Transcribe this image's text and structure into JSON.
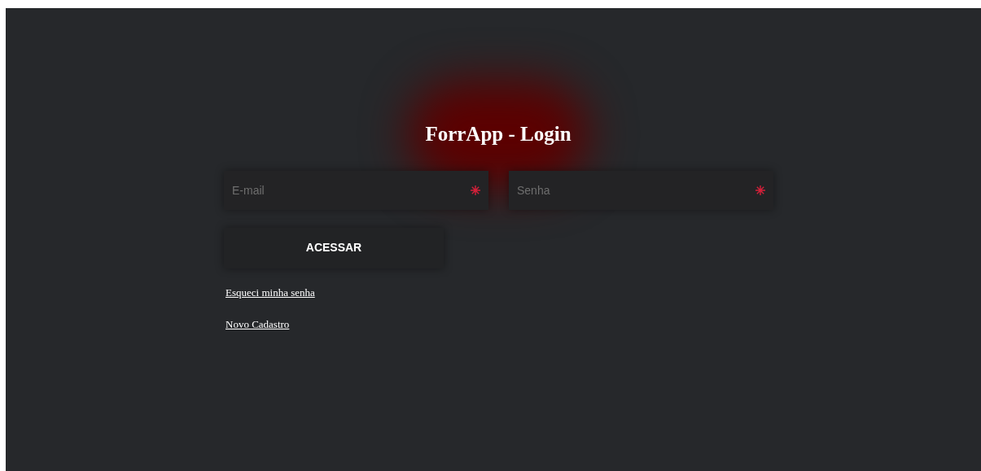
{
  "title": "ForrApp - Login",
  "fields": [
    {
      "placeholder": "E-mail",
      "required": true
    },
    {
      "placeholder": "Senha",
      "required": true
    }
  ],
  "button": "ACESSAR",
  "links": [
    "Esqueci minha senha",
    "Novo Cadastro"
  ]
}
